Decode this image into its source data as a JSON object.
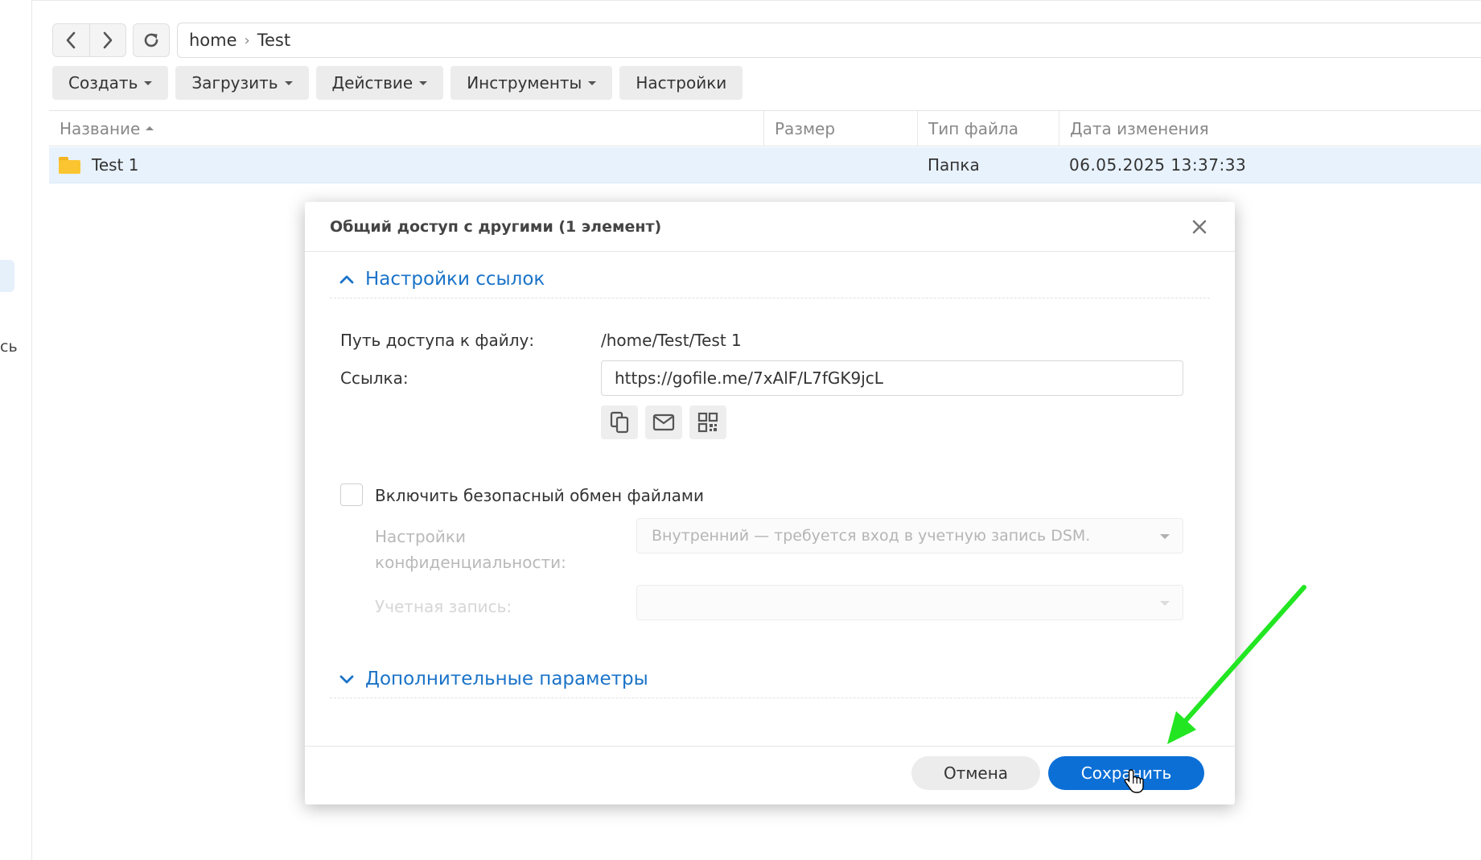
{
  "address": {
    "path": [
      "home",
      "Test"
    ]
  },
  "toolbar": {
    "create_label": "Создать",
    "upload_label": "Загрузить",
    "action_label": "Действие",
    "tools_label": "Инструменты",
    "settings_label": "Настройки"
  },
  "sidebar": {
    "cut_label": "сь"
  },
  "file_list": {
    "columns": [
      "Название",
      "Размер",
      "Тип файла",
      "Дата изменения"
    ],
    "rows": [
      {
        "name": "Test 1",
        "size": "",
        "type": "Папка",
        "modified": "06.05.2025 13:37:33"
      }
    ]
  },
  "dialog": {
    "title": "Общий доступ с другими (1 элемент)",
    "link_settings": {
      "heading": "Настройки ссылок",
      "path_label": "Путь доступа к файлу:",
      "path_value": "/home/Test/Test 1",
      "link_label": "Ссылка:",
      "link_value": "https://gofile.me/7xAlF/L7fGK9jcL"
    },
    "secure_share": {
      "checkbox_label": "Включить безопасный обмен файлами",
      "checked": false,
      "privacy_label_line1": "Настройки",
      "privacy_label_line2": "конфиденциальности:",
      "privacy_value": "Внутренний — требуется вход в учетную запись DSM.",
      "account_label": "Учетная запись:",
      "account_value": ""
    },
    "advanced": {
      "heading": "Дополнительные параметры"
    },
    "buttons": {
      "cancel": "Отмена",
      "save": "Сохранить"
    }
  },
  "colors": {
    "accent": "#0b6fd6",
    "link_heading": "#1a73c8",
    "selected_row": "#e8f2fc",
    "annotation_arrow": "#22e622",
    "folder": "#fbc531"
  },
  "icons": {
    "back": "chevron-left-icon",
    "forward": "chevron-right-icon",
    "refresh": "refresh-icon",
    "copy": "copy-icon",
    "email": "mail-icon",
    "qr": "qr-code-icon",
    "close": "close-icon",
    "folder": "folder-icon"
  }
}
